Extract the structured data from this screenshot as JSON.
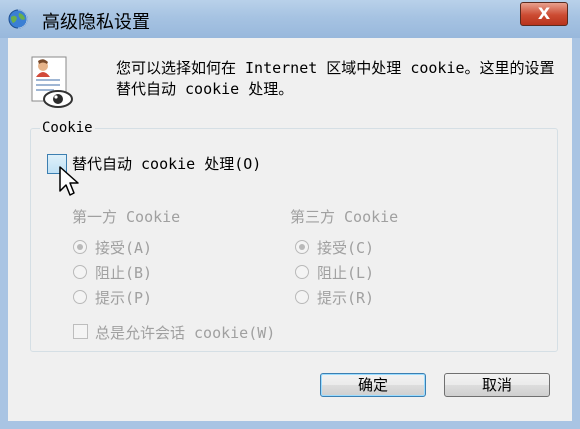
{
  "window": {
    "title": "高级隐私设置",
    "close_symbol": "X",
    "title_icon": "globe-icon"
  },
  "info": {
    "icon": "privacy-certificate-eye-icon",
    "text": "您可以选择如何在 Internet 区域中处理 cookie。这里的设置替代自动 cookie 处理。"
  },
  "group": {
    "title": "Cookie",
    "override_label": "替代自动 cookie 处理(O)",
    "override_checked": false,
    "first_party": {
      "heading": "第一方 Cookie",
      "options": [
        "接受(A)",
        "阻止(B)",
        "提示(P)"
      ],
      "selected": "接受(A)"
    },
    "third_party": {
      "heading": "第三方 Cookie",
      "options": [
        "接受(C)",
        "阻止(L)",
        "提示(R)"
      ],
      "selected": "接受(C)"
    },
    "session_label": "总是允许会话 cookie(W)",
    "session_checked": false
  },
  "buttons": {
    "ok": "确定",
    "cancel": "取消"
  }
}
